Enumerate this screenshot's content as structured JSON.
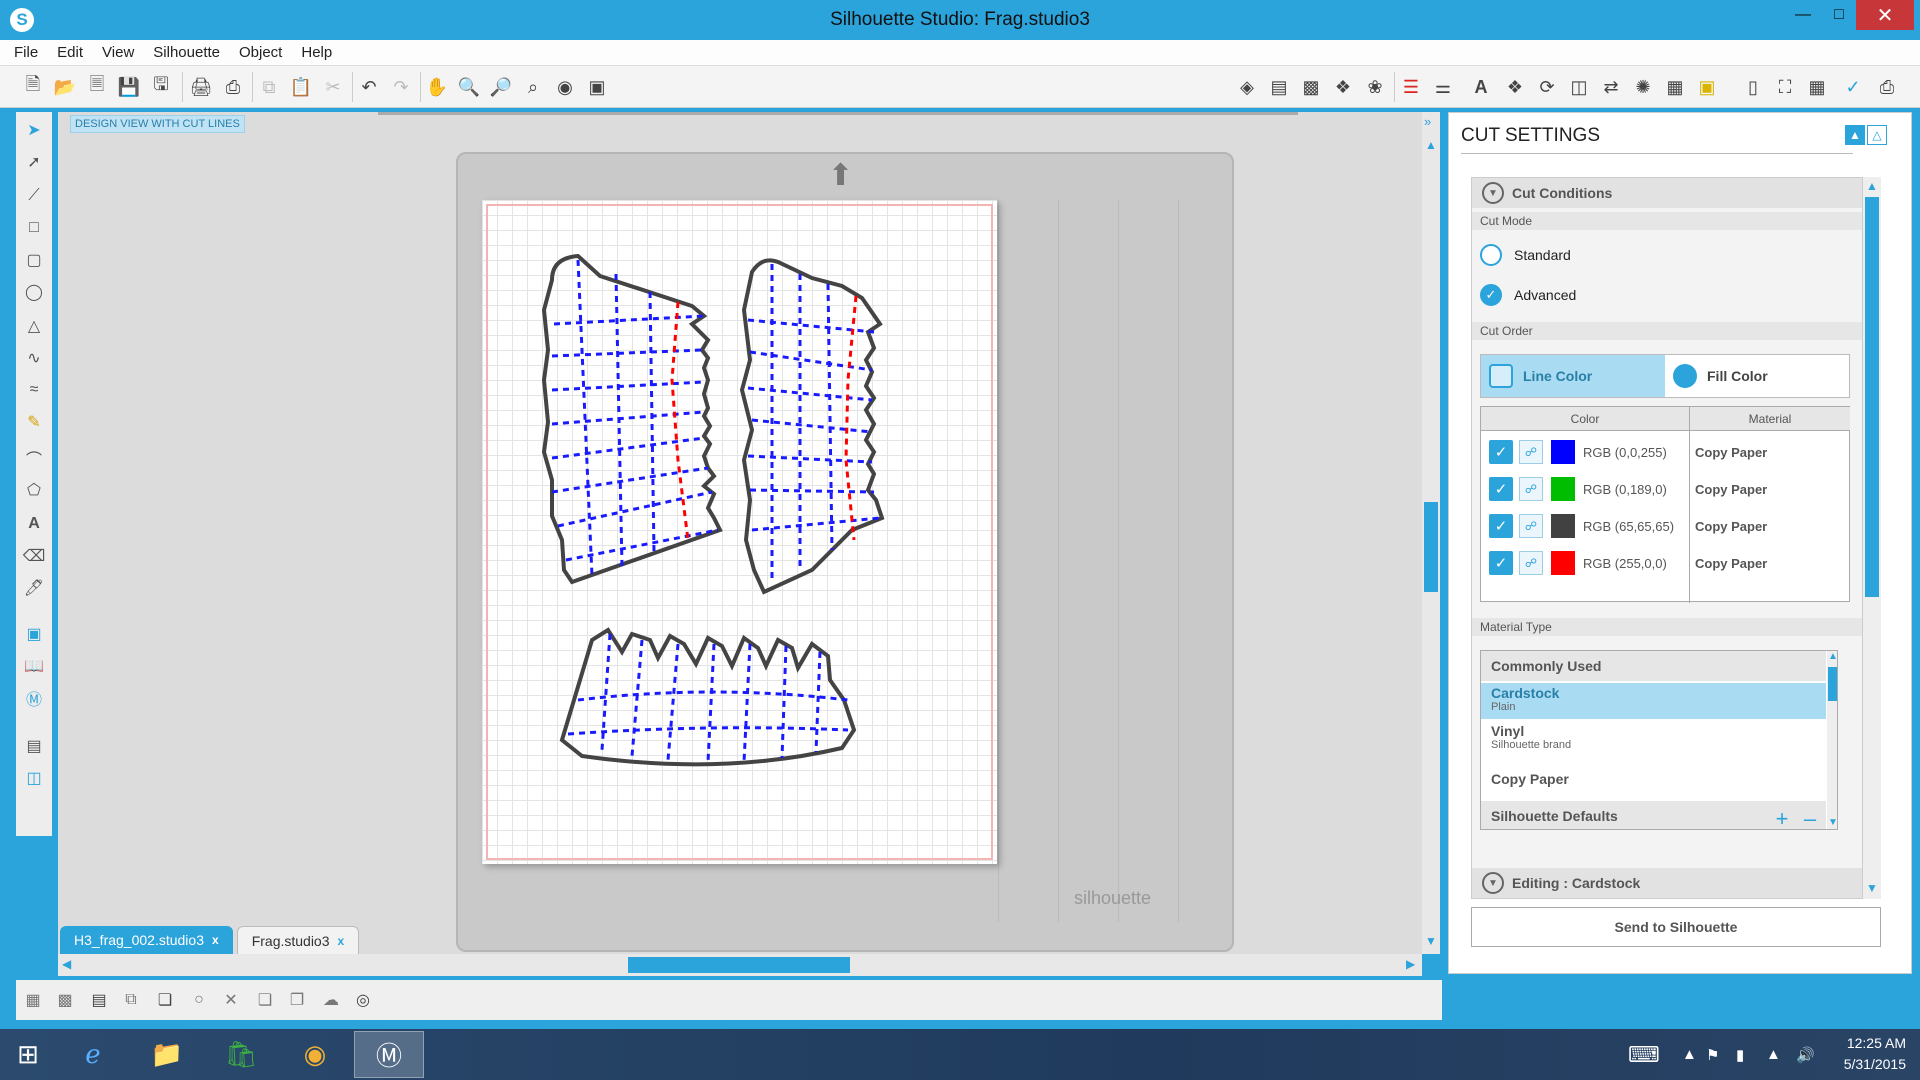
{
  "window": {
    "title": "Silhouette Studio: Frag.studio3",
    "app_icon": "S"
  },
  "menu": [
    "File",
    "Edit",
    "View",
    "Silhouette",
    "Object",
    "Help"
  ],
  "canvas": {
    "view_label": "DESIGN VIEW WITH CUT LINES",
    "mat_brand": "silhouette"
  },
  "doc_tabs": [
    {
      "label": "H3_frag_002.studio3",
      "close": "x"
    },
    {
      "label": "Frag.studio3",
      "close": "x"
    }
  ],
  "panel": {
    "title": "CUT SETTINGS",
    "cut_conditions": "Cut Conditions",
    "cut_mode_label": "Cut Mode",
    "modes": [
      "Standard",
      "Advanced"
    ],
    "cut_order_label": "Cut Order",
    "order_options": [
      "Line Color",
      "Fill Color"
    ],
    "table_headers": {
      "color": "Color",
      "material": "Material"
    },
    "rows": [
      {
        "rgb": "RGB (0,0,255)",
        "swatch": "#0000ff",
        "material": "Copy Paper"
      },
      {
        "rgb": "RGB (0,189,0)",
        "swatch": "#00bd00",
        "material": "Copy Paper"
      },
      {
        "rgb": "RGB (65,65,65)",
        "swatch": "#414141",
        "material": "Copy Paper"
      },
      {
        "rgb": "RGB (255,0,0)",
        "swatch": "#ff0000",
        "material": "Copy Paper"
      }
    ],
    "material_type_label": "Material Type",
    "materials": {
      "commonly_used": "Commonly Used",
      "cardstock": "Cardstock",
      "cardstock_sub": "Plain",
      "vinyl": "Vinyl",
      "vinyl_sub": "Silhouette brand",
      "copy_paper": "Copy Paper",
      "defaults": "Silhouette Defaults"
    },
    "editing": "Editing : Cardstock",
    "send_button": "Send to Silhouette"
  },
  "taskbar": {
    "time": "12:25 AM",
    "date": "5/31/2015"
  },
  "colors": {
    "accent": "#2ba3db",
    "close": "#c7373a"
  }
}
